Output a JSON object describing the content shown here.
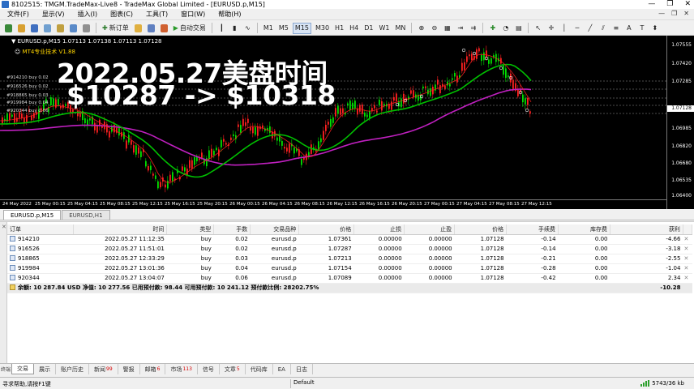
{
  "window": {
    "title": "8102515: TMGM.TradeMax-Live8 - TradeMax Global Limited - [EURUSD.p,M15]",
    "controls": [
      "—",
      "❐",
      "✕"
    ]
  },
  "menu": {
    "items": [
      "文件(F)",
      "显示(V)",
      "插入(I)",
      "图表(C)",
      "工具(T)",
      "窗口(W)",
      "帮助(H)"
    ],
    "right_controls": [
      "—",
      "❐",
      "✕"
    ]
  },
  "toolbar": {
    "new_order": "新订单",
    "auto_trading": "自动交易",
    "timeframes": [
      "M1",
      "M5",
      "M15",
      "M30",
      "H1",
      "H4",
      "D1",
      "W1",
      "MN"
    ]
  },
  "chart": {
    "symbol_info": "EURUSD.p,M15  1.07113 1.07138 1.07113 1.07128",
    "ea_label": "MT4专业技术 V1.88",
    "overlay_line1": "2022.05.27美盘时间",
    "overlay_line2": "$10287 -> $10318",
    "order_labels": [
      "#914210 buy 0.02",
      "#916526 buy 0.02",
      "#918865 buy 0.03",
      "#919984 buy 0.04",
      "#920344 buy 0.06"
    ],
    "price_ticks": [
      "1.07555",
      "1.07420",
      "1.07285",
      "1.07128",
      "1.06985",
      "1.06820",
      "1.06680",
      "1.06535",
      "1.06400"
    ],
    "current_price": "1.07128",
    "time_ticks": [
      "24 May 2022",
      "25 May 00:15",
      "25 May 04:15",
      "25 May 08:15",
      "25 May 12:15",
      "25 May 16:15",
      "25 May 20:15",
      "26 May 00:15",
      "26 May 04:15",
      "26 May 08:15",
      "26 May 12:15",
      "26 May 16:15",
      "26 May 20:15",
      "27 May 00:15",
      "27 May 04:15",
      "27 May 08:15",
      "27 May 12:15"
    ],
    "colors": {
      "bull": "#00e000",
      "bear": "#ff2020",
      "ma_fast": "#ff2020",
      "ma_slow": "#00c000",
      "ma_long": "#c020c0",
      "background": "#000000"
    }
  },
  "chart_tabs": [
    "EURUSD.p,M15",
    "EURUSD,H1"
  ],
  "terminal": {
    "columns": [
      "订单",
      "时间",
      "类型",
      "手数",
      "交易品种",
      "价格",
      "止损",
      "止盈",
      "价格",
      "手续费",
      "库存费",
      "获利"
    ],
    "rows": [
      [
        "914210",
        "2022.05.27 11:12:35",
        "buy",
        "0.02",
        "eurusd.p",
        "1.07361",
        "0.00000",
        "0.00000",
        "1.07128",
        "-0.14",
        "0.00",
        "-4.66"
      ],
      [
        "916526",
        "2022.05.27 11:51:01",
        "buy",
        "0.02",
        "eurusd.p",
        "1.07287",
        "0.00000",
        "0.00000",
        "1.07128",
        "-0.14",
        "0.00",
        "-3.18"
      ],
      [
        "918865",
        "2022.05.27 12:33:29",
        "buy",
        "0.03",
        "eurusd.p",
        "1.07213",
        "0.00000",
        "0.00000",
        "1.07128",
        "-0.21",
        "0.00",
        "-2.55"
      ],
      [
        "919984",
        "2022.05.27 13:01:36",
        "buy",
        "0.04",
        "eurusd.p",
        "1.07154",
        "0.00000",
        "0.00000",
        "1.07128",
        "-0.28",
        "0.00",
        "-1.04"
      ],
      [
        "920344",
        "2022.05.27 13:04:07",
        "buy",
        "0.06",
        "eurusd.p",
        "1.07089",
        "0.00000",
        "0.00000",
        "1.07128",
        "-0.42",
        "0.00",
        "2.34"
      ]
    ],
    "balance_line": "余额: 10 287.84 USD  净值: 10 277.56  已用预付款: 98.44  可用预付款: 10 241.12  预付款比例: 28202.75%",
    "balance_profit": "-10.28"
  },
  "bottom_tabs": [
    {
      "label": "交易",
      "badge": ""
    },
    {
      "label": "展示",
      "badge": ""
    },
    {
      "label": "账户历史",
      "badge": ""
    },
    {
      "label": "新闻",
      "badge": "99"
    },
    {
      "label": "警报",
      "badge": ""
    },
    {
      "label": "邮箱",
      "badge": "6"
    },
    {
      "label": "市场",
      "badge": "113"
    },
    {
      "label": "信号",
      "badge": ""
    },
    {
      "label": "文章",
      "badge": "5"
    },
    {
      "label": "代码库",
      "badge": ""
    },
    {
      "label": "EA",
      "badge": ""
    },
    {
      "label": "日志",
      "badge": ""
    }
  ],
  "terminal_side_label": "终端",
  "status": {
    "help": "寻求帮助,请按F1键",
    "profile": "Default",
    "connection": "5743/36 kb"
  }
}
